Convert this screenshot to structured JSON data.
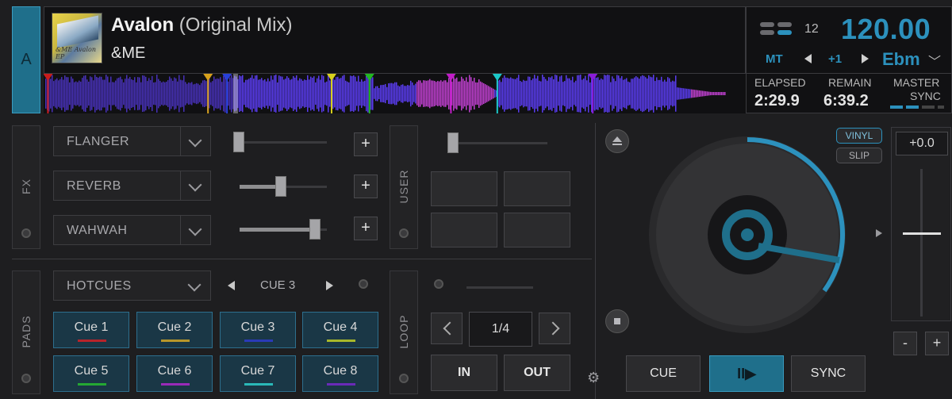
{
  "deck": {
    "letter": "A"
  },
  "track": {
    "title": "Avalon",
    "mix": "(Original Mix)",
    "artist": "&ME",
    "artwork_text": "&ME Avalon EP"
  },
  "info": {
    "key_number": "12",
    "bpm": "120.00",
    "mt_label": "MT",
    "pitch_step": "+1",
    "key": "Ebm",
    "elapsed_label": "ELAPSED",
    "elapsed": "2:29.9",
    "remain_label": "REMAIN",
    "remain": "6:39.2",
    "master_label": "MASTER",
    "sync_label": "SYNC"
  },
  "waveform": {
    "markers": [
      {
        "color": "#c81d1d",
        "pos": 0.005
      },
      {
        "color": "#d8a21c",
        "pos": 0.233
      },
      {
        "color": "#2740d8",
        "pos": 0.26
      },
      {
        "color": "#d8d01c",
        "pos": 0.409
      },
      {
        "color": "#22b822",
        "pos": 0.463
      },
      {
        "color": "#c21cc8",
        "pos": 0.579
      },
      {
        "color": "#1cc8c8",
        "pos": 0.645
      },
      {
        "color": "#8a1cd8",
        "pos": 0.781
      }
    ],
    "playhead": 0.27
  },
  "fx": {
    "tab_label": "FX",
    "slots": [
      {
        "name": "FLANGER",
        "level": 0.0
      },
      {
        "name": "REVERB",
        "level": 0.55
      },
      {
        "name": "WAHWAH",
        "level": 1.0
      }
    ],
    "plus_label": "+"
  },
  "user": {
    "tab_label": "USER",
    "level": 0.0
  },
  "pads": {
    "tab_label": "PADS",
    "mode": "HOTCUES",
    "page": "CUE 3",
    "items": [
      {
        "label": "Cue 1",
        "color": "#b8232a"
      },
      {
        "label": "Cue 2",
        "color": "#b8962a"
      },
      {
        "label": "Cue 3",
        "color": "#2a3ab8"
      },
      {
        "label": "Cue 4",
        "color": "#a8b82a"
      },
      {
        "label": "Cue 5",
        "color": "#24a832"
      },
      {
        "label": "Cue 6",
        "color": "#9a2ab8"
      },
      {
        "label": "Cue 7",
        "color": "#2ab8b8"
      },
      {
        "label": "Cue 8",
        "color": "#6a2ab8"
      }
    ]
  },
  "loop": {
    "tab_label": "LOOP",
    "size": "1/4",
    "in_label": "IN",
    "out_label": "OUT"
  },
  "jog": {
    "vinyl_label": "VINYL",
    "slip_label": "SLIP",
    "progress": 0.35
  },
  "transport": {
    "cue_label": "CUE",
    "play_label": "II▶",
    "sync_label": "SYNC"
  },
  "pitch": {
    "value": "+0.0",
    "minus_label": "-",
    "plus_label": "+"
  },
  "colors": {
    "accent": "#2c91bd",
    "wave": "#5a3cf0",
    "wave_hi": "#c040d0"
  }
}
